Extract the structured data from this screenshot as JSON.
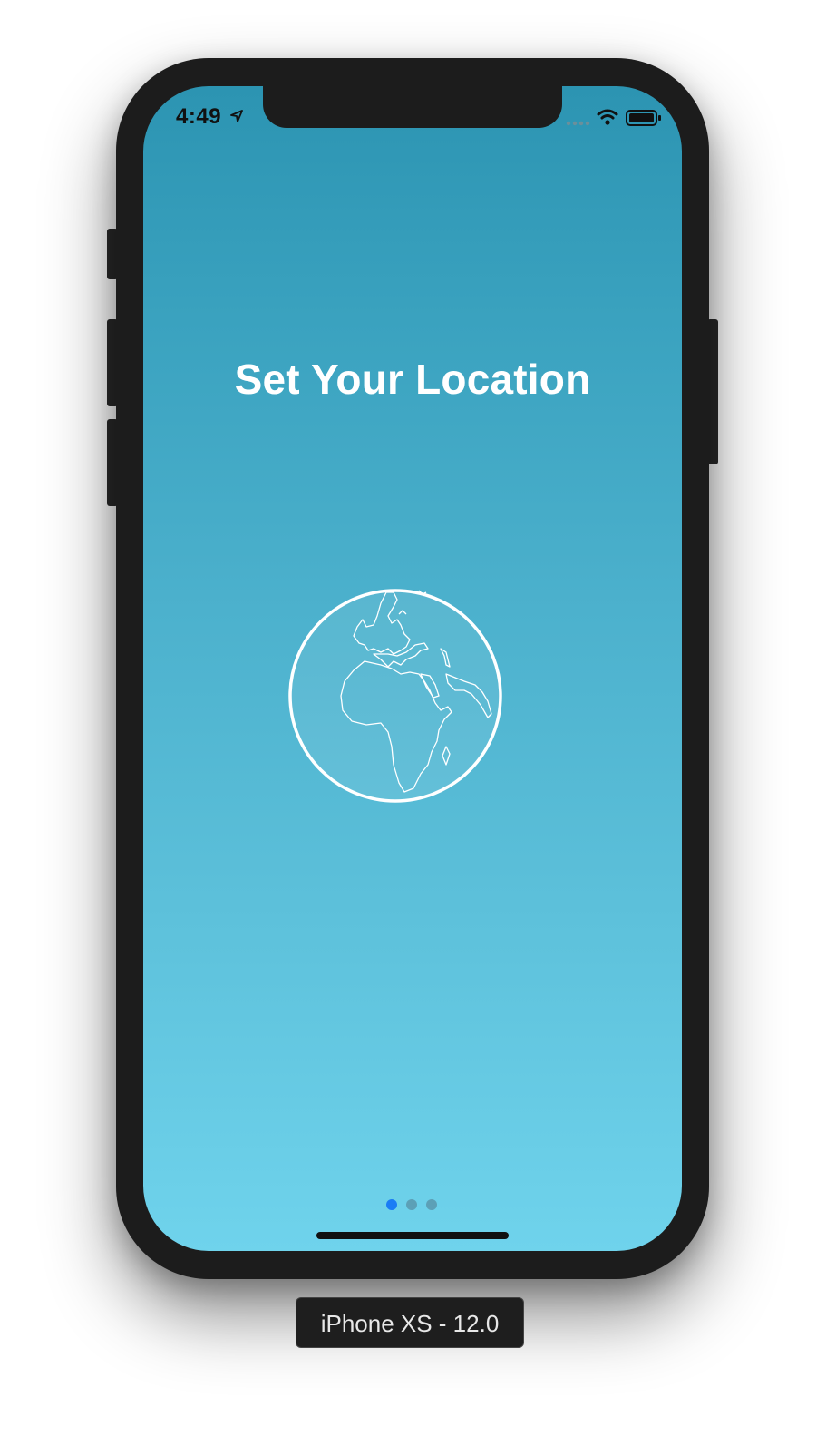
{
  "status_bar": {
    "time": "4:49",
    "icons": [
      "location-arrow-icon",
      "signal-dots-icon",
      "wifi-icon",
      "battery-icon"
    ]
  },
  "screen": {
    "title": "Set Your Location",
    "illustration": "globe-icon",
    "pager": {
      "count": 3,
      "active_index": 0
    }
  },
  "device_label": "iPhone XS - 12.0",
  "colors": {
    "gradient_top": "#2c94b2",
    "gradient_bottom": "#6fd3ec",
    "active_dot": "#1a7cf5",
    "device_frame": "#1c1c1c"
  }
}
